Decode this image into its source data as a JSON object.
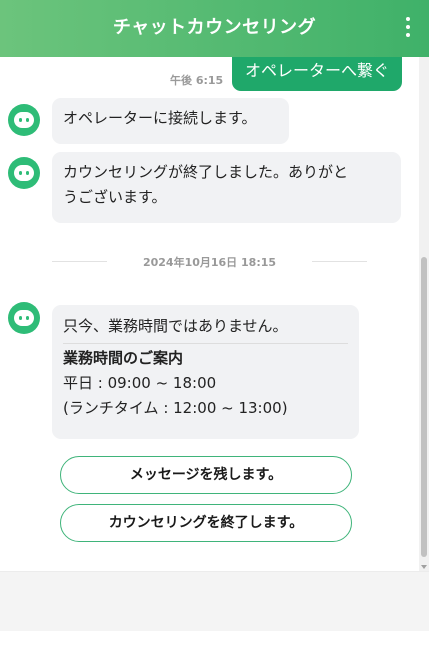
{
  "header": {
    "title": "チャットカウンセリング",
    "menu_icon": "kebab-menu-icon",
    "gradient_start": "#6cc47c",
    "gradient_end": "#3fb169"
  },
  "operator_button": {
    "label": "オペレーターへ繋ぐ",
    "color": "#1fa86a"
  },
  "messages": [
    {
      "time": "午後 6:15"
    },
    {
      "sender_icon": "bot-avatar-icon",
      "text": "オペレーターに接続します。"
    },
    {
      "sender_icon": "bot-avatar-icon",
      "text_line1": "カウンセリングが終了しました。ありがと",
      "text_line2": "うございます。"
    }
  ],
  "date_separator": "2024年10月16日 18:15",
  "business_hours_message": {
    "sender_icon": "bot-avatar-icon",
    "intro": "只今、業務時間ではありません。",
    "title": "業務時間のご案内",
    "weekday": "平日 : 09:00 ~ 18:00",
    "lunch": "(ランチタイム : 12:00 ~ 13:00)"
  },
  "actions": [
    {
      "label": "メッセージを残します。"
    },
    {
      "label": "カウンセリングを終了します。"
    }
  ],
  "colors": {
    "accent": "#2ebc77",
    "bubble_bg": "#f1f2f4",
    "button_border": "#3fb47a"
  }
}
